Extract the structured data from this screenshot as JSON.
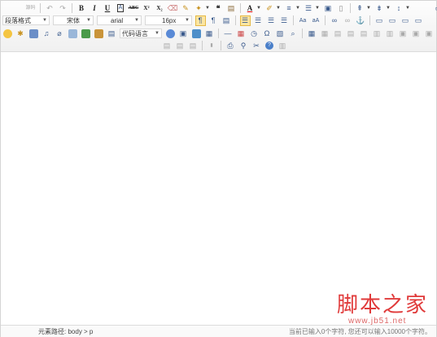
{
  "toolbar": {
    "row1": {
      "source_label": "源码",
      "bold": "B",
      "italic": "I",
      "underline": "U",
      "strike": "ABC",
      "superscript": "X²",
      "subscript": "X₂",
      "quote": "❝",
      "font_color": "A"
    },
    "row2": {
      "paragraph_format": "段落格式",
      "font_family_cn": "宋体",
      "font_family": "arial",
      "font_size": "16px"
    },
    "row3": {
      "language": "代码语言"
    }
  },
  "status": {
    "path_label": "元素路径:",
    "path_value": "body > p",
    "word_count": "当前已输入0个字符, 您还可以输入10000个字符。"
  },
  "watermark": {
    "cn": "脚本之家",
    "en": "www.jb51.net"
  },
  "colors": {
    "active_bg": "#fbe6a2",
    "watermark": "#e03a3a"
  }
}
